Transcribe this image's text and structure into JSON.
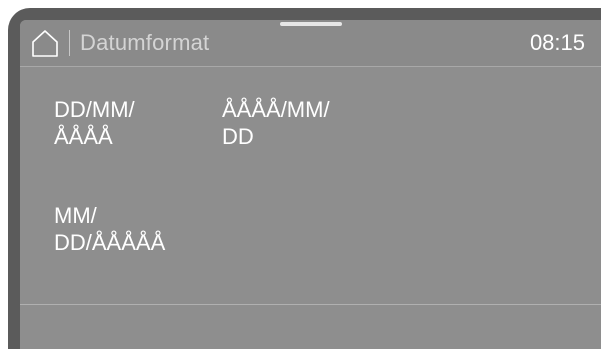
{
  "header": {
    "home_icon": "home-icon",
    "title": "Datumformat",
    "clock": "08:15"
  },
  "options": [
    {
      "line1": "DD/MM/",
      "line2": "ÅÅÅÅ"
    },
    {
      "line1": "ÅÅÅÅ/MM/",
      "line2": "DD"
    },
    {
      "line1": "MM/",
      "line2": "DD/ÅÅÅÅÅ"
    }
  ]
}
